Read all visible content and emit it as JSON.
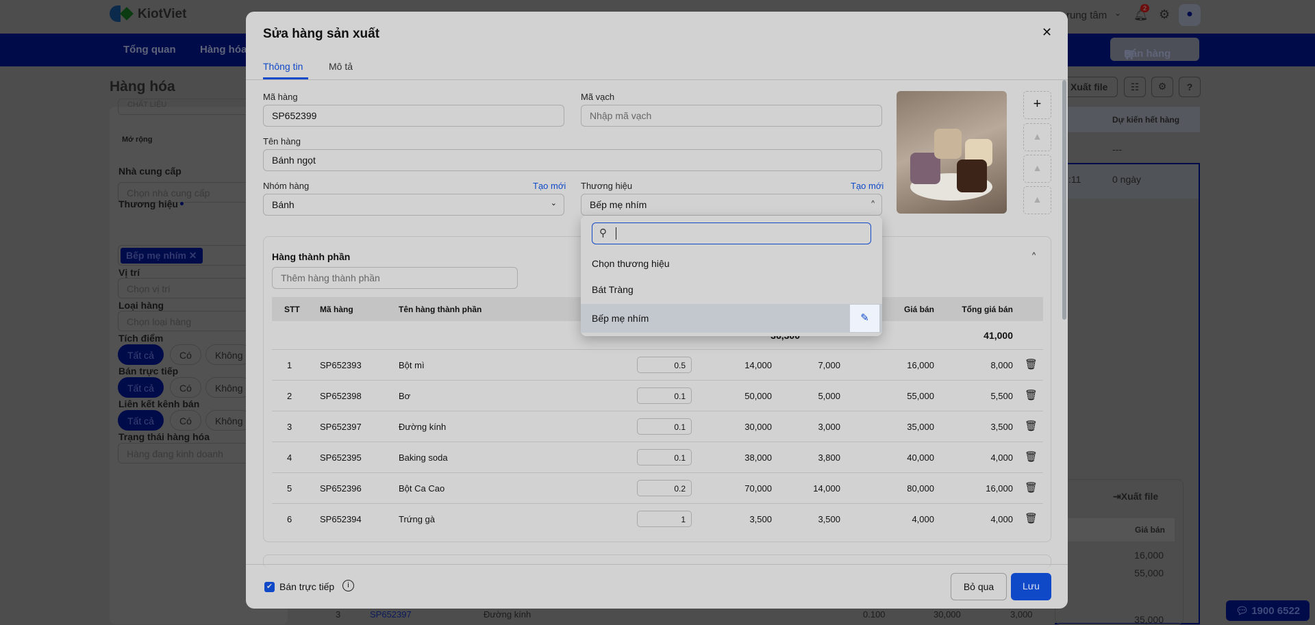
{
  "app": {
    "logo": "KiotViet",
    "branch": "rung tâm",
    "notif_count": "2",
    "sell_button": "Bán hàng"
  },
  "nav": [
    "Tổng quan",
    "Hàng hóa"
  ],
  "page": {
    "title": "Hàng hóa",
    "export": "Xuất file",
    "col_header": "Dự kiến hết hàng",
    "row1": "---",
    "row2_time": ":11",
    "row2": "0 ngày",
    "lower_export": "Xuất file",
    "lower_header": "Giá bán",
    "lower_values": [
      "16,000",
      "55,000",
      "35,000"
    ],
    "bg_row": {
      "stt": "3",
      "code": "SP652397",
      "name": "Đường kính",
      "qty": "0.100",
      "cost": "30,000",
      "price": "3,000"
    }
  },
  "sidebar": {
    "cut": "CHẤT LIỆU",
    "expand": "Mở rộng",
    "supplier_label": "Nhà cung cấp",
    "supplier_ph": "Chọn nhà cung cấp",
    "brand_label": "Thương hiệu",
    "brand_tag": "Bếp mẹ nhím",
    "location_label": "Vị trí",
    "location_ph": "Chọn vị trí",
    "type_label": "Loại hàng",
    "type_ph": "Chọn loại hàng",
    "points_label": "Tích điểm",
    "direct_label": "Bán trực tiếp",
    "channel_label": "Liên kết kênh bán",
    "pills": [
      "Tất cả",
      "Có",
      "Không"
    ],
    "status_label": "Trạng thái hàng hóa",
    "status_value": "Hàng đang kinh doanh"
  },
  "modal": {
    "title": "Sửa hàng sản xuất",
    "tabs": [
      "Thông tin",
      "Mô tả"
    ],
    "code_label": "Mã hàng",
    "code": "SP652399",
    "barcode_label": "Mã vạch",
    "barcode_ph": "Nhập mã vạch",
    "name_label": "Tên hàng",
    "name": "Bánh ngọt",
    "group_label": "Nhóm hàng",
    "group": "Bánh",
    "create_new": "Tạo mới",
    "brand_label": "Thương hiệu",
    "brand": "Bếp mẹ nhím",
    "section_title": "Hàng thành phần",
    "add_ph": "Thêm hàng thành phần",
    "headers": {
      "stt": "STT",
      "code": "Mã hàng",
      "name": "Tên hàng thành phần",
      "price": "Giá bán",
      "total": "Tổng giá bán"
    },
    "totals": {
      "cost": "36,300",
      "total": "41,000"
    },
    "rows": [
      {
        "stt": "1",
        "code": "SP652393",
        "name": "Bột mì",
        "qty": "0.5",
        "unit_cost": "14,000",
        "cost": "7,000",
        "price": "16,000",
        "total": "8,000"
      },
      {
        "stt": "2",
        "code": "SP652398",
        "name": "Bơ",
        "qty": "0.1",
        "unit_cost": "50,000",
        "cost": "5,000",
        "price": "55,000",
        "total": "5,500"
      },
      {
        "stt": "3",
        "code": "SP652397",
        "name": "Đường kính",
        "qty": "0.1",
        "unit_cost": "30,000",
        "cost": "3,000",
        "price": "35,000",
        "total": "3,500"
      },
      {
        "stt": "4",
        "code": "SP652395",
        "name": "Baking soda",
        "qty": "0.1",
        "unit_cost": "38,000",
        "cost": "3,800",
        "price": "40,000",
        "total": "4,000"
      },
      {
        "stt": "5",
        "code": "SP652396",
        "name": "Bột Ca Cao",
        "qty": "0.2",
        "unit_cost": "70,000",
        "cost": "14,000",
        "price": "80,000",
        "total": "16,000"
      },
      {
        "stt": "6",
        "code": "SP652394",
        "name": "Trứng gà",
        "qty": "1",
        "unit_cost": "3,500",
        "cost": "3,500",
        "price": "4,000",
        "total": "4,000"
      }
    ],
    "direct_sale": "Bán trực tiếp",
    "cancel": "Bỏ qua",
    "save": "Lưu"
  },
  "dropdown": {
    "options": [
      "Chọn thương hiệu",
      "Bát Tràng",
      "Bếp mẹ nhím"
    ]
  },
  "chat": "1900 6522",
  "colors": {
    "accent": "#1049c8",
    "navy": "#000b4a"
  }
}
